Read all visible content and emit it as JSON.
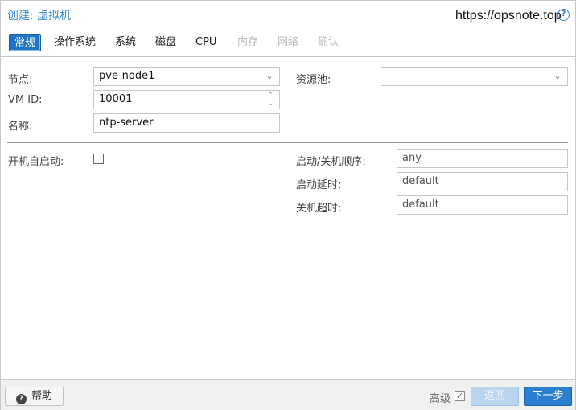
{
  "window": {
    "title": "创建: 虚拟机",
    "watermark": "https://opsnote.top"
  },
  "tabs": [
    {
      "label": "常规",
      "state": "active"
    },
    {
      "label": "操作系统",
      "state": "enabled"
    },
    {
      "label": "系统",
      "state": "enabled"
    },
    {
      "label": "磁盘",
      "state": "enabled"
    },
    {
      "label": "CPU",
      "state": "enabled"
    },
    {
      "label": "内存",
      "state": "disabled"
    },
    {
      "label": "网络",
      "state": "disabled"
    },
    {
      "label": "确认",
      "state": "disabled"
    }
  ],
  "form": {
    "node_label": "节点:",
    "node_value": "pve-node1",
    "vmid_label": "VM ID:",
    "vmid_value": "10001",
    "name_label": "名称:",
    "name_value": "ntp-server",
    "pool_label": "资源池:",
    "pool_value": "",
    "onboot_label": "开机自启动:",
    "onboot_checked": false,
    "order_label": "启动/关机顺序:",
    "order_placeholder": "any",
    "startup_delay_label": "启动延时:",
    "startup_delay_placeholder": "default",
    "shutdown_timeout_label": "关机超时:",
    "shutdown_timeout_placeholder": "default"
  },
  "footer": {
    "help_label": "帮助",
    "advanced_label": "高级",
    "advanced_checked": true,
    "back_label": "返回",
    "next_label": "下一步"
  },
  "colors": {
    "accent": "#1f76c6",
    "title": "#3f8ad1",
    "disabled_tab": "#b9b9b9"
  }
}
